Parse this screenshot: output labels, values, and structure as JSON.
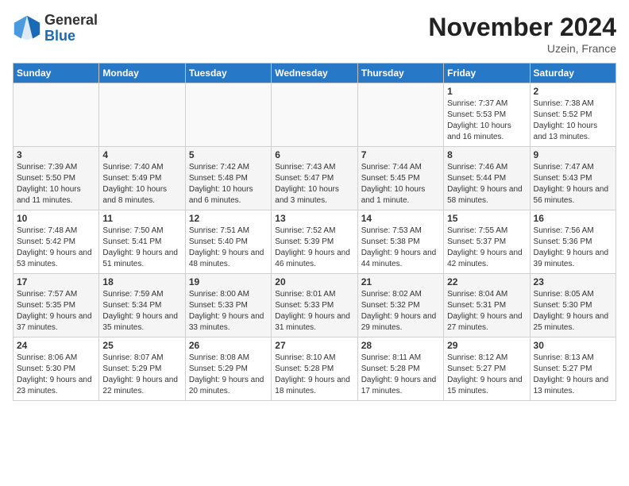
{
  "header": {
    "logo_line1": "General",
    "logo_line2": "Blue",
    "month": "November 2024",
    "location": "Uzein, France"
  },
  "weekdays": [
    "Sunday",
    "Monday",
    "Tuesday",
    "Wednesday",
    "Thursday",
    "Friday",
    "Saturday"
  ],
  "weeks": [
    [
      {
        "day": "",
        "info": ""
      },
      {
        "day": "",
        "info": ""
      },
      {
        "day": "",
        "info": ""
      },
      {
        "day": "",
        "info": ""
      },
      {
        "day": "",
        "info": ""
      },
      {
        "day": "1",
        "info": "Sunrise: 7:37 AM\nSunset: 5:53 PM\nDaylight: 10 hours and 16 minutes."
      },
      {
        "day": "2",
        "info": "Sunrise: 7:38 AM\nSunset: 5:52 PM\nDaylight: 10 hours and 13 minutes."
      }
    ],
    [
      {
        "day": "3",
        "info": "Sunrise: 7:39 AM\nSunset: 5:50 PM\nDaylight: 10 hours and 11 minutes."
      },
      {
        "day": "4",
        "info": "Sunrise: 7:40 AM\nSunset: 5:49 PM\nDaylight: 10 hours and 8 minutes."
      },
      {
        "day": "5",
        "info": "Sunrise: 7:42 AM\nSunset: 5:48 PM\nDaylight: 10 hours and 6 minutes."
      },
      {
        "day": "6",
        "info": "Sunrise: 7:43 AM\nSunset: 5:47 PM\nDaylight: 10 hours and 3 minutes."
      },
      {
        "day": "7",
        "info": "Sunrise: 7:44 AM\nSunset: 5:45 PM\nDaylight: 10 hours and 1 minute."
      },
      {
        "day": "8",
        "info": "Sunrise: 7:46 AM\nSunset: 5:44 PM\nDaylight: 9 hours and 58 minutes."
      },
      {
        "day": "9",
        "info": "Sunrise: 7:47 AM\nSunset: 5:43 PM\nDaylight: 9 hours and 56 minutes."
      }
    ],
    [
      {
        "day": "10",
        "info": "Sunrise: 7:48 AM\nSunset: 5:42 PM\nDaylight: 9 hours and 53 minutes."
      },
      {
        "day": "11",
        "info": "Sunrise: 7:50 AM\nSunset: 5:41 PM\nDaylight: 9 hours and 51 minutes."
      },
      {
        "day": "12",
        "info": "Sunrise: 7:51 AM\nSunset: 5:40 PM\nDaylight: 9 hours and 48 minutes."
      },
      {
        "day": "13",
        "info": "Sunrise: 7:52 AM\nSunset: 5:39 PM\nDaylight: 9 hours and 46 minutes."
      },
      {
        "day": "14",
        "info": "Sunrise: 7:53 AM\nSunset: 5:38 PM\nDaylight: 9 hours and 44 minutes."
      },
      {
        "day": "15",
        "info": "Sunrise: 7:55 AM\nSunset: 5:37 PM\nDaylight: 9 hours and 42 minutes."
      },
      {
        "day": "16",
        "info": "Sunrise: 7:56 AM\nSunset: 5:36 PM\nDaylight: 9 hours and 39 minutes."
      }
    ],
    [
      {
        "day": "17",
        "info": "Sunrise: 7:57 AM\nSunset: 5:35 PM\nDaylight: 9 hours and 37 minutes."
      },
      {
        "day": "18",
        "info": "Sunrise: 7:59 AM\nSunset: 5:34 PM\nDaylight: 9 hours and 35 minutes."
      },
      {
        "day": "19",
        "info": "Sunrise: 8:00 AM\nSunset: 5:33 PM\nDaylight: 9 hours and 33 minutes."
      },
      {
        "day": "20",
        "info": "Sunrise: 8:01 AM\nSunset: 5:33 PM\nDaylight: 9 hours and 31 minutes."
      },
      {
        "day": "21",
        "info": "Sunrise: 8:02 AM\nSunset: 5:32 PM\nDaylight: 9 hours and 29 minutes."
      },
      {
        "day": "22",
        "info": "Sunrise: 8:04 AM\nSunset: 5:31 PM\nDaylight: 9 hours and 27 minutes."
      },
      {
        "day": "23",
        "info": "Sunrise: 8:05 AM\nSunset: 5:30 PM\nDaylight: 9 hours and 25 minutes."
      }
    ],
    [
      {
        "day": "24",
        "info": "Sunrise: 8:06 AM\nSunset: 5:30 PM\nDaylight: 9 hours and 23 minutes."
      },
      {
        "day": "25",
        "info": "Sunrise: 8:07 AM\nSunset: 5:29 PM\nDaylight: 9 hours and 22 minutes."
      },
      {
        "day": "26",
        "info": "Sunrise: 8:08 AM\nSunset: 5:29 PM\nDaylight: 9 hours and 20 minutes."
      },
      {
        "day": "27",
        "info": "Sunrise: 8:10 AM\nSunset: 5:28 PM\nDaylight: 9 hours and 18 minutes."
      },
      {
        "day": "28",
        "info": "Sunrise: 8:11 AM\nSunset: 5:28 PM\nDaylight: 9 hours and 17 minutes."
      },
      {
        "day": "29",
        "info": "Sunrise: 8:12 AM\nSunset: 5:27 PM\nDaylight: 9 hours and 15 minutes."
      },
      {
        "day": "30",
        "info": "Sunrise: 8:13 AM\nSunset: 5:27 PM\nDaylight: 9 hours and 13 minutes."
      }
    ]
  ]
}
